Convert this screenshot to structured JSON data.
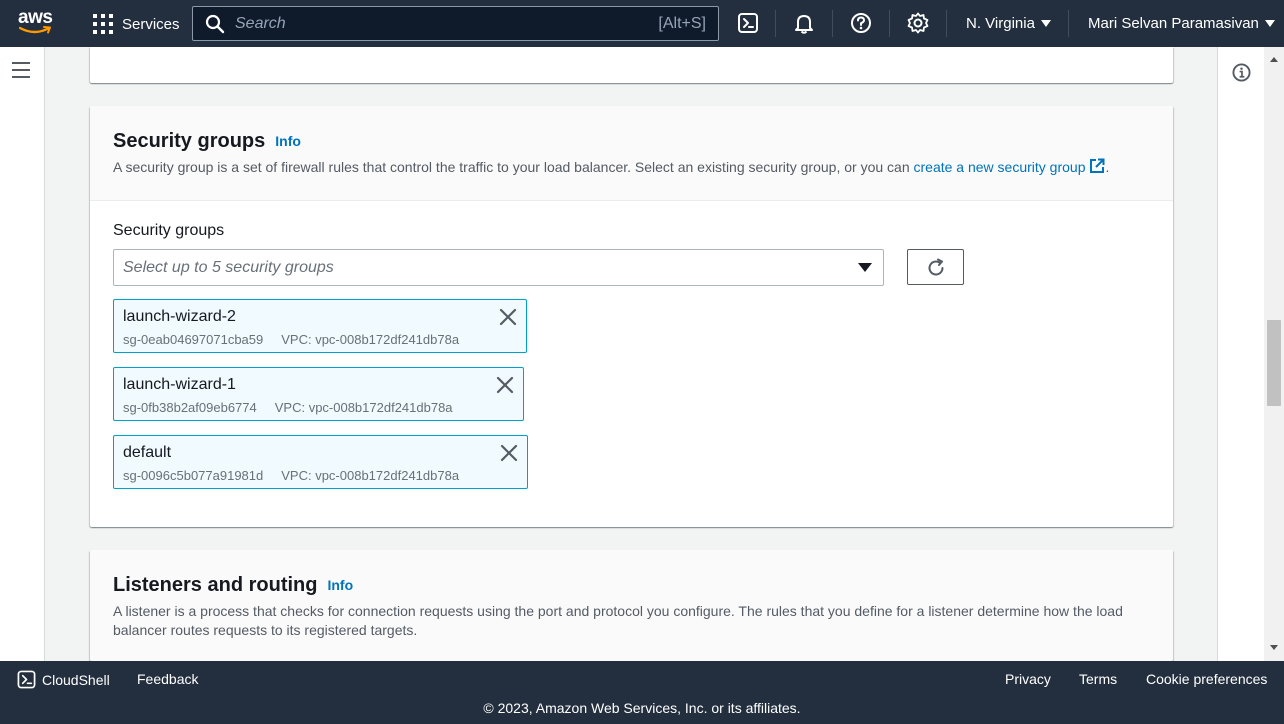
{
  "topnav": {
    "logo_text": "aws",
    "services_label": "Services",
    "search_placeholder": "Search",
    "search_shortcut": "[Alt+S]",
    "region": "N. Virginia",
    "user": "Mari Selvan Paramasivan",
    "icons": [
      "cloudshell-icon",
      "bell-icon",
      "help-icon",
      "settings-icon"
    ]
  },
  "security_groups_section": {
    "title": "Security groups",
    "info_label": "Info",
    "description": "A security group is a set of firewall rules that control the traffic to your load balancer. Select an existing security group, or you can ",
    "description_link": "create a new security group",
    "description_end": ".",
    "field_label": "Security groups",
    "select_placeholder": "Select up to 5 security groups",
    "tokens": [
      {
        "name": "launch-wizard-2",
        "id": "sg-0eab04697071cba59",
        "vpc": "VPC: vpc-008b172df241db78a"
      },
      {
        "name": "launch-wizard-1",
        "id": "sg-0fb38b2af09eb6774",
        "vpc": "VPC: vpc-008b172df241db78a"
      },
      {
        "name": "default",
        "id": "sg-0096c5b077a91981d",
        "vpc": "VPC: vpc-008b172df241db78a"
      }
    ]
  },
  "listeners_section": {
    "title": "Listeners and routing",
    "info_label": "Info",
    "description_line1": "A listener is a process that checks for connection requests using the port and protocol you configure. The rules that you define for a listener determine how the load",
    "description_line2": "balancer routes requests to its registered targets."
  },
  "footer": {
    "cloudshell": "CloudShell",
    "feedback": "Feedback",
    "privacy": "Privacy",
    "terms": "Terms",
    "cookie": "Cookie preferences",
    "copyright": "© 2023, Amazon Web Services, Inc. or its affiliates."
  },
  "colors": {
    "nav_bg": "#232f3e",
    "link": "#0073bb",
    "token_border": "#00a1c9",
    "token_bg": "#f1faff"
  }
}
